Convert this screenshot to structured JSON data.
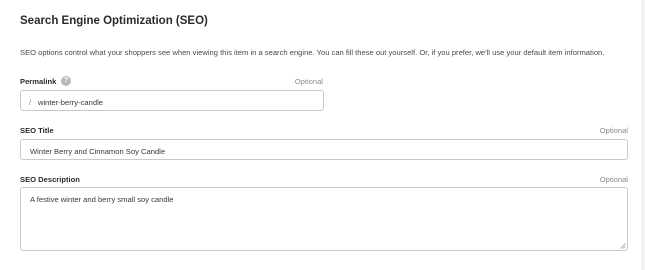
{
  "seo": {
    "title": "Search Engine Optimization (SEO)",
    "description": "SEO options control what your shoppers see when viewing this item in a search engine. You can fill these out yourself. Or, if you prefer, we'll use your default item information.",
    "permalink": {
      "label": "Permalink",
      "help_icon": "question-circle-icon",
      "help_glyph": "?",
      "optional": "Optional",
      "prefix": "/",
      "value": "winter-berry-candle"
    },
    "seo_title": {
      "label": "SEO Title",
      "optional": "Optional",
      "value": "Winter Berry and Cinnamon Soy Candle"
    },
    "seo_description": {
      "label": "SEO Description",
      "optional": "Optional",
      "value": "A festive winter and berry small soy candle"
    }
  }
}
